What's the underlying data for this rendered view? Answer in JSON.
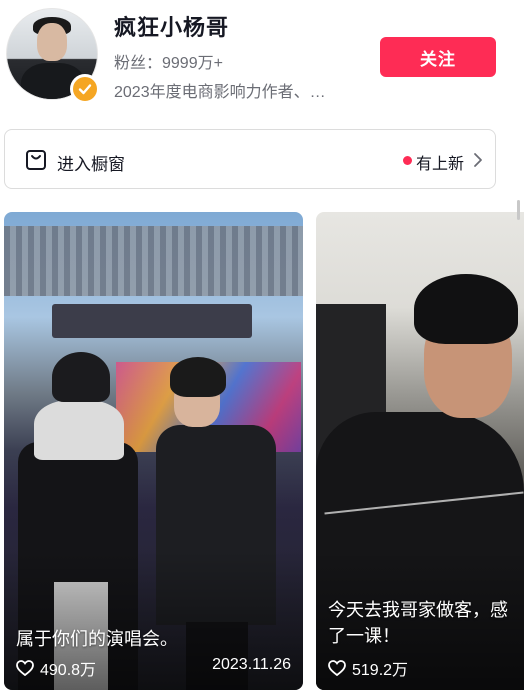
{
  "profile": {
    "name": "疯狂小杨哥",
    "fans": "粉丝：9999万+",
    "description": "2023年度电商影响力作者、…",
    "follow_label": "关注"
  },
  "shop_window": {
    "label": "进入橱窗",
    "new_label": "有上新",
    "icon": "shopping-bag-icon"
  },
  "videos": [
    {
      "caption": "属于你们的演唱会。",
      "likes": "490.8万",
      "date": "2023.11.26"
    },
    {
      "caption_line1": "今天去我哥家做客，感",
      "caption_line2": "了一课！",
      "likes": "519.2万"
    }
  ],
  "colors": {
    "accent": "#fe2c55",
    "verify_badge": "#f5a623"
  }
}
